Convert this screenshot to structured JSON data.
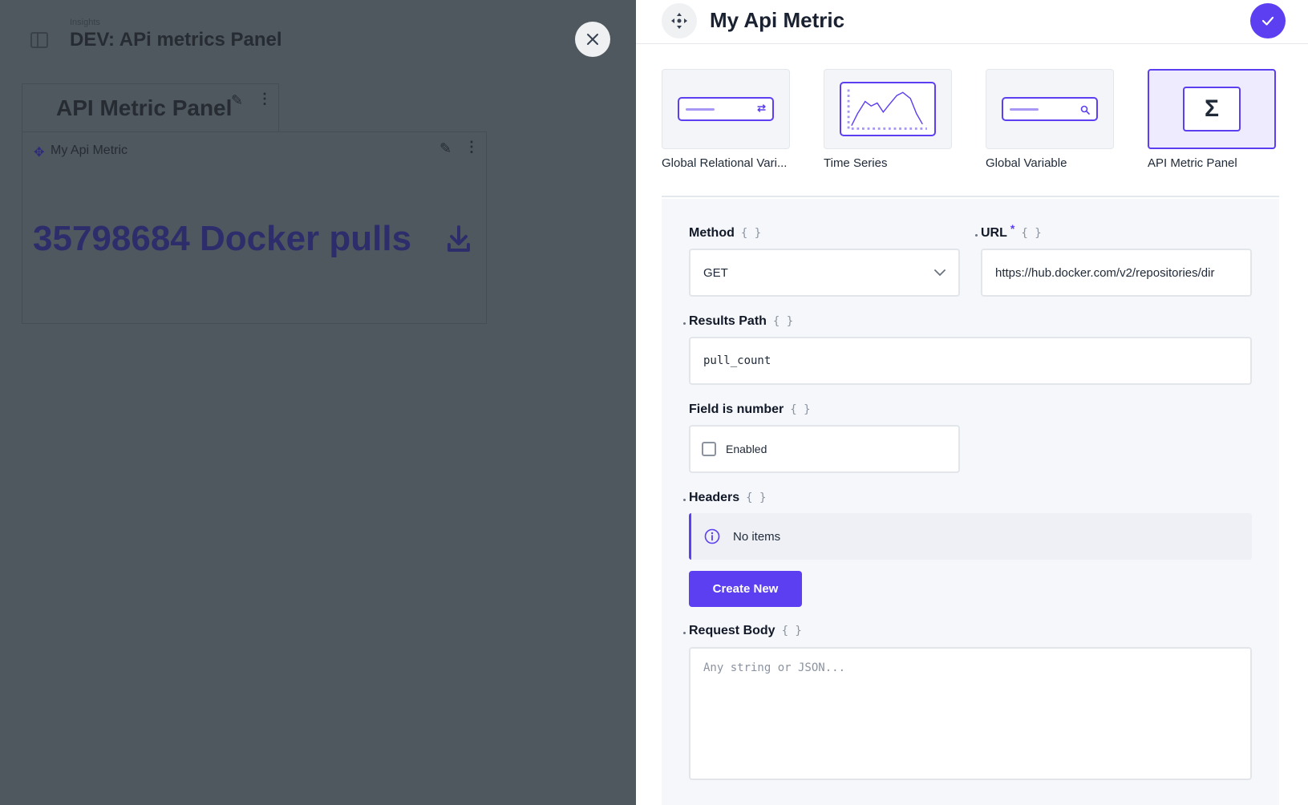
{
  "background": {
    "breadcrumb": "Insights",
    "dashboard_title": "DEV: APi metrics Panel",
    "tab_title": "API Metric Panel",
    "card_title": "My Api Metric",
    "card_metric": "35798684 Docker pulls"
  },
  "drawer": {
    "title": "My Api Metric",
    "panel_types": [
      {
        "label": "Global Relational Vari...",
        "icon": "relational-variable-icon"
      },
      {
        "label": "Time Series",
        "icon": "time-series-icon"
      },
      {
        "label": "Global Variable",
        "icon": "global-variable-icon"
      },
      {
        "label": "API Metric Panel",
        "icon": "sigma-icon",
        "selected": true
      }
    ],
    "form": {
      "method": {
        "label": "Method",
        "value": "GET"
      },
      "url": {
        "label": "URL",
        "required_mark": "*",
        "value": "https://hub.docker.com/v2/repositories/dir"
      },
      "results_path": {
        "label": "Results Path",
        "value": "pull_count"
      },
      "field_is_number": {
        "label": "Field is number",
        "checkbox_label": "Enabled",
        "checked": false
      },
      "headers": {
        "label": "Headers",
        "empty_text": "No items",
        "create_button": "Create New"
      },
      "request_body": {
        "label": "Request Body",
        "placeholder": "Any string or JSON..."
      }
    }
  },
  "colors": {
    "accent": "#5b3ff0",
    "overlay": "#4f585f",
    "form_bg": "#f5f7fa"
  }
}
